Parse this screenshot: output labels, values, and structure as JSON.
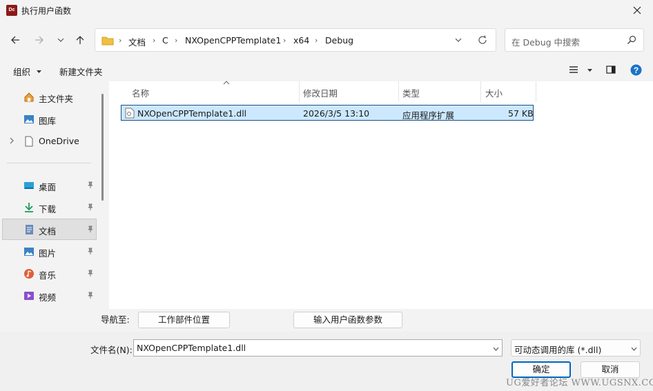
{
  "window": {
    "app_icon_text": "Dc",
    "title": "执行用户函数"
  },
  "address_bar": {
    "crumbs": [
      "文档",
      "C",
      "NXOpenCPPTemplate1",
      "x64",
      "Debug"
    ]
  },
  "search": {
    "placeholder": "在 Debug 中搜索"
  },
  "command_bar": {
    "organize": "组织",
    "new_folder": "新建文件夹"
  },
  "sidebar": {
    "items": [
      {
        "label": "主文件夹",
        "icon": "home-icon"
      },
      {
        "label": "图库",
        "icon": "gallery-icon"
      },
      {
        "label": "OneDrive",
        "icon": "onedrive-icon"
      },
      {
        "label": "桌面",
        "icon": "desktop-icon"
      },
      {
        "label": "下载",
        "icon": "download-icon"
      },
      {
        "label": "文档",
        "icon": "documents-icon"
      },
      {
        "label": "图片",
        "icon": "pictures-icon"
      },
      {
        "label": "音乐",
        "icon": "music-icon"
      },
      {
        "label": "视频",
        "icon": "videos-icon"
      }
    ]
  },
  "file_list": {
    "columns": [
      "名称",
      "修改日期",
      "类型",
      "大小"
    ],
    "rows": [
      {
        "name": "NXOpenCPPTemplate1.dll",
        "modified": "2026/3/5 13:10",
        "type": "应用程序扩展",
        "size": "57 KB"
      }
    ]
  },
  "navigate": {
    "label": "导航至:",
    "work_part_button": "工作部件位置",
    "input_params_button": "输入用户函数参数"
  },
  "footer": {
    "filename_label": "文件名(N):",
    "filename_value": "NXOpenCPPTemplate1.dll",
    "filetype_value": "可动态调用的库 (*.dll)",
    "ok_label": "确定",
    "cancel_label": "取消",
    "watermark": "UG爱好者论坛 WWW.UGSNX.COM"
  },
  "colors": {
    "accent": "#0067c0",
    "selection": "#cce8ff",
    "folder": "#f0c040"
  }
}
